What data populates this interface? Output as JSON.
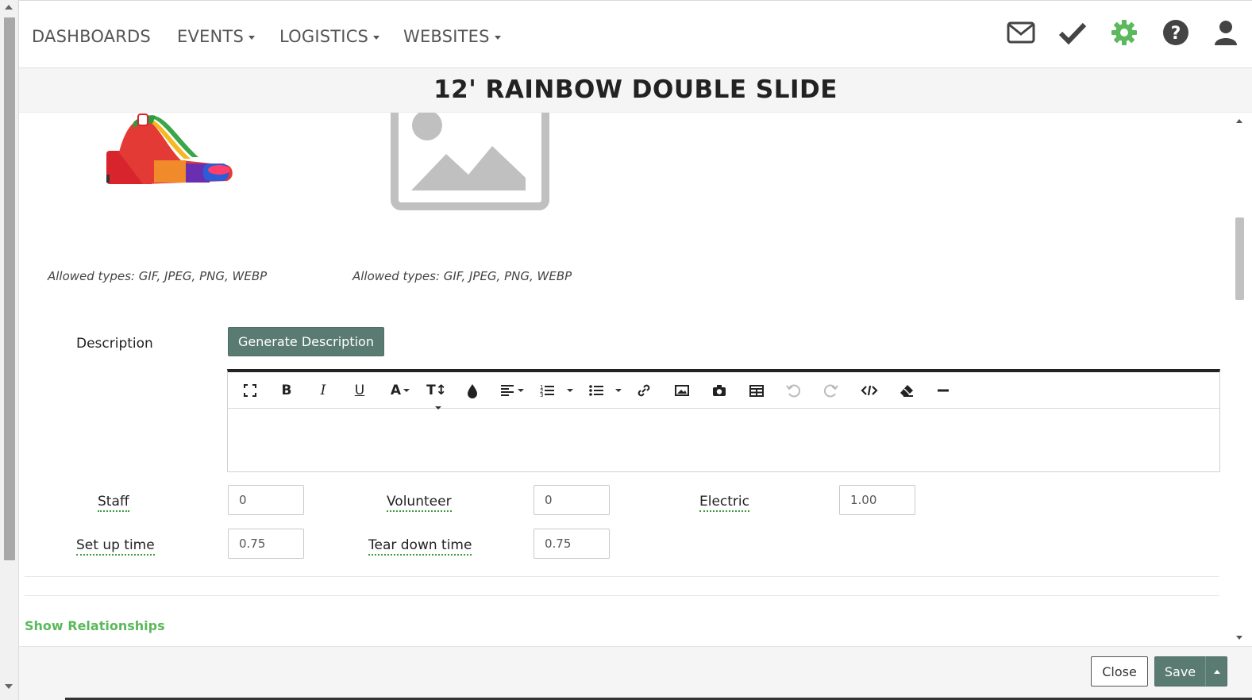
{
  "nav": {
    "items": [
      {
        "label": "DASHBOARDS",
        "has_caret": false
      },
      {
        "label": "EVENTS",
        "has_caret": true
      },
      {
        "label": "LOGISTICS",
        "has_caret": true
      },
      {
        "label": "WEBSITES",
        "has_caret": true
      }
    ],
    "icons": [
      "envelope-icon",
      "checkmark-icon",
      "gear-icon",
      "help-icon",
      "user-icon"
    ],
    "gear_color": "#5cb85c"
  },
  "title": "12' RAINBOW DOUBLE SLIDE",
  "images": {
    "allowed_types_1": "Allowed types: GIF, JPEG, PNG, WEBP",
    "allowed_types_2": "Allowed types: GIF, JPEG, PNG, WEBP"
  },
  "description": {
    "label": "Description",
    "generate_button": "Generate Description",
    "toolbar": [
      "fullscreen",
      "bold",
      "italic",
      "underline",
      "font-color",
      "font-size",
      "highlight",
      "align",
      "ordered-list",
      "unordered-list",
      "link",
      "image",
      "camera",
      "table",
      "undo",
      "redo",
      "code-view",
      "eraser",
      "horizontal-rule"
    ]
  },
  "fields": {
    "staff": {
      "label": "Staff",
      "value": "0"
    },
    "volunteer": {
      "label": "Volunteer",
      "value": "0"
    },
    "electric": {
      "label": "Electric",
      "value": "1.00"
    },
    "setup": {
      "label": "Set up time",
      "value": "0.75"
    },
    "teardown": {
      "label": "Tear down time",
      "value": "0.75"
    }
  },
  "relationships": {
    "label": "Show Relationships"
  },
  "footer": {
    "close_label": "Close",
    "save_label": "Save"
  },
  "colors": {
    "accent": "#5a7b72",
    "link_green": "#5cb85c"
  }
}
